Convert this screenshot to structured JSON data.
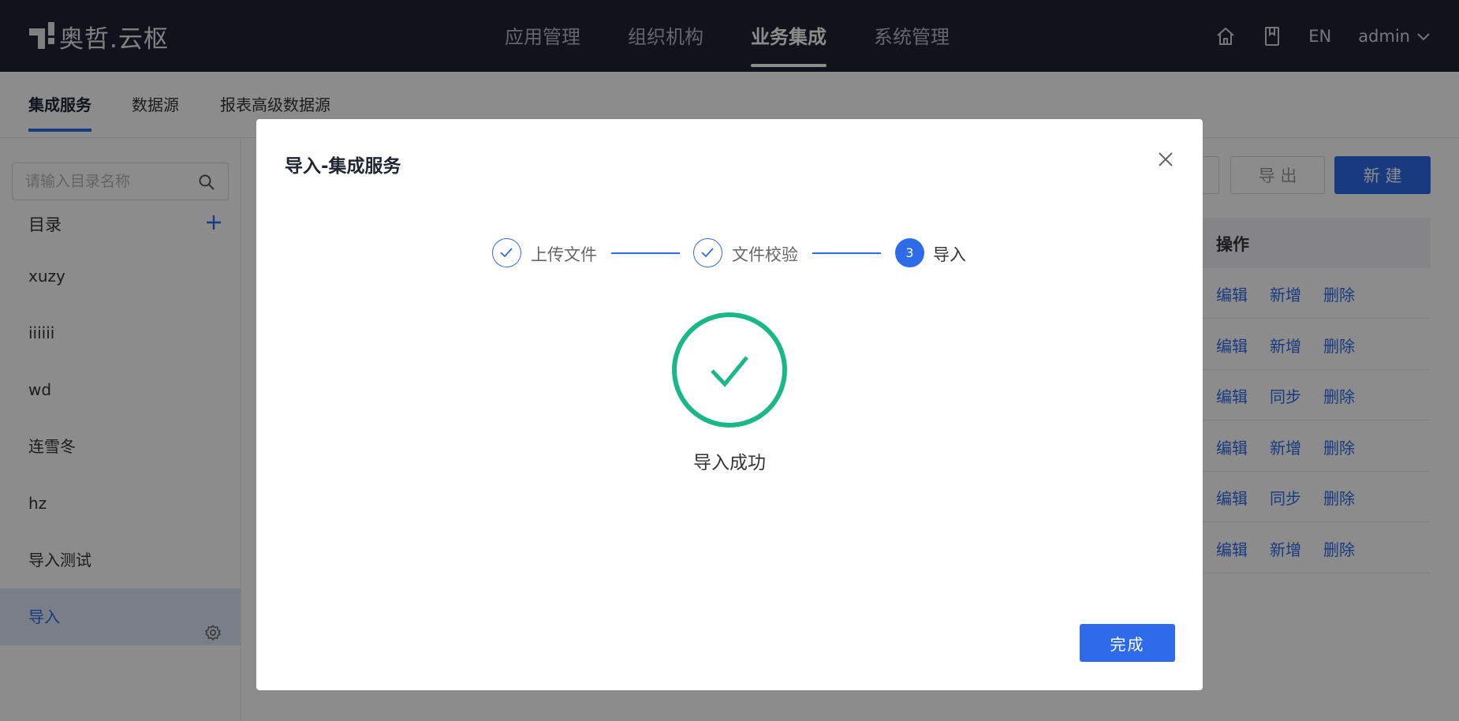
{
  "header": {
    "logo_text": "奥哲.云枢",
    "nav": [
      {
        "label": "应用管理"
      },
      {
        "label": "组织机构"
      },
      {
        "label": "业务集成"
      },
      {
        "label": "系统管理"
      }
    ],
    "lang": "EN",
    "user": "admin"
  },
  "subnav": {
    "tabs": [
      {
        "label": "集成服务"
      },
      {
        "label": "数据源"
      },
      {
        "label": "报表高级数据源"
      }
    ]
  },
  "sidebar": {
    "search_placeholder": "请输入目录名称",
    "dir_title": "目录",
    "items": [
      {
        "label": "xuzy"
      },
      {
        "label": "iiiiii"
      },
      {
        "label": "wd"
      },
      {
        "label": "连雪冬"
      },
      {
        "label": "hz"
      },
      {
        "label": "导入测试"
      },
      {
        "label": "导入"
      }
    ]
  },
  "main": {
    "export_label": "导 出",
    "new_label": "新 建",
    "actions_header": "操作",
    "rows": [
      {
        "a": "编辑",
        "b": "新增",
        "c": "删除"
      },
      {
        "a": "编辑",
        "b": "新增",
        "c": "删除"
      },
      {
        "a": "编辑",
        "b": "同步",
        "c": "删除"
      },
      {
        "a": "编辑",
        "b": "新增",
        "c": "删除"
      },
      {
        "a": "编辑",
        "b": "同步",
        "c": "删除"
      },
      {
        "a": "编辑",
        "b": "新增",
        "c": "删除"
      }
    ]
  },
  "modal": {
    "title": "导入-集成服务",
    "steps": [
      {
        "label": "上传文件",
        "status": "done"
      },
      {
        "label": "文件校验",
        "status": "done"
      },
      {
        "label": "导入",
        "status": "current",
        "number": "3"
      }
    ],
    "result_text": "导入成功",
    "done_label": "完成"
  },
  "colors": {
    "primary": "#2d6be8",
    "success": "#1ab788",
    "topbar": "#1f2433"
  }
}
